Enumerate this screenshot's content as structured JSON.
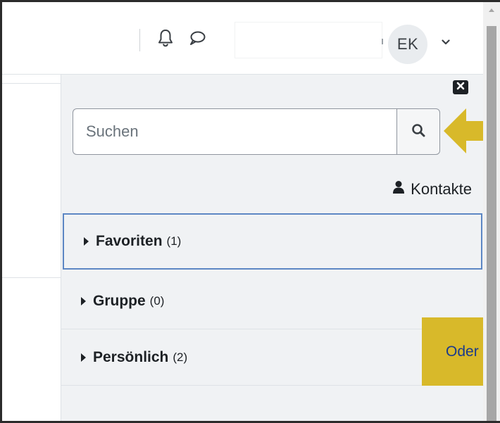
{
  "header": {
    "user_initials": "EK"
  },
  "drawer": {
    "search": {
      "placeholder": "Suchen"
    },
    "contacts_label": "Kontakte",
    "sections": [
      {
        "title": "Favoriten",
        "count": "(1)"
      },
      {
        "title": "Gruppe",
        "count": "(0)"
      },
      {
        "title": "Persönlich",
        "count": "(2)"
      }
    ]
  },
  "tour": {
    "callout_text": "Oder a",
    "accent_color": "#d8b92a"
  },
  "colors": {
    "focus_border": "#5d87c4",
    "drawer_bg": "#f0f2f4"
  },
  "icons": [
    "bell-icon",
    "chat-bubble-icon",
    "chevron-down-icon",
    "close-icon",
    "search-icon",
    "user-icon",
    "caret-right-icon",
    "arrow-left-icon"
  ]
}
